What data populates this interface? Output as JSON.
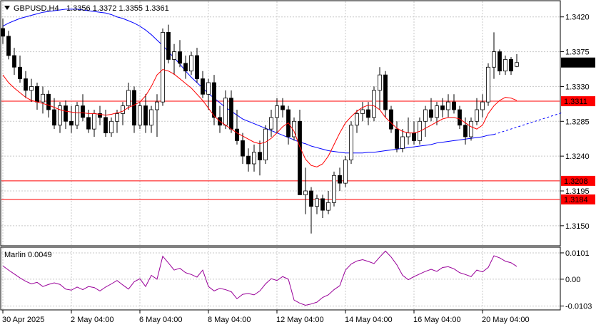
{
  "chart_data": {
    "type": "candlestick",
    "symbol_header": "GBPUSD,H4",
    "ohlc_header": "1.3356 1.3372 1.3355 1.3361",
    "price_axis": {
      "ylim": [
        1.3125,
        1.344
      ],
      "tick_labels": [
        "1.3420",
        "1.3375",
        "1.3330",
        "1.3285",
        "1.3240",
        "1.3195",
        "1.3150"
      ]
    },
    "time_axis": {
      "labels": [
        "30 Apr 2025",
        "2 May 04:00",
        "6 May 04:00",
        "8 May 04:00",
        "12 May 04:00",
        "14 May 04:00",
        "16 May 04:00",
        "20 May 04:00"
      ],
      "label_bar_index": [
        0,
        12,
        24,
        36,
        48,
        60,
        72,
        84
      ]
    },
    "current_price": {
      "value": 1.3361,
      "label": "1.3361"
    },
    "horizontal_levels": [
      {
        "value": 1.3311,
        "label": "1.3311",
        "color": "#ff0000"
      },
      {
        "value": 1.3208,
        "label": "1.3208",
        "color": "#ff0000"
      },
      {
        "value": 1.3184,
        "label": "1.3184",
        "color": "#ff0000"
      }
    ],
    "candles": [
      [
        1.3405,
        1.3418,
        1.3385,
        1.3395
      ],
      [
        1.3395,
        1.3402,
        1.3365,
        1.337
      ],
      [
        1.337,
        1.338,
        1.3345,
        1.3355
      ],
      [
        1.3355,
        1.337,
        1.3335,
        1.334
      ],
      [
        1.334,
        1.335,
        1.3315,
        1.3325
      ],
      [
        1.3325,
        1.334,
        1.331,
        1.333
      ],
      [
        1.333,
        1.3335,
        1.33,
        1.331
      ],
      [
        1.331,
        1.333,
        1.3295,
        1.332
      ],
      [
        1.332,
        1.3325,
        1.329,
        1.33
      ],
      [
        1.33,
        1.3315,
        1.3275,
        1.328
      ],
      [
        1.328,
        1.331,
        1.327,
        1.3305
      ],
      [
        1.3305,
        1.3312,
        1.3275,
        1.3285
      ],
      [
        1.3285,
        1.3305,
        1.327,
        1.328
      ],
      [
        1.328,
        1.331,
        1.3275,
        1.3305
      ],
      [
        1.3305,
        1.332,
        1.3285,
        1.329
      ],
      [
        1.329,
        1.33,
        1.327,
        1.3275
      ],
      [
        1.3275,
        1.33,
        1.3265,
        1.3295
      ],
      [
        1.3295,
        1.3305,
        1.328,
        1.329
      ],
      [
        1.329,
        1.33,
        1.3265,
        1.327
      ],
      [
        1.327,
        1.329,
        1.3265,
        1.3285
      ],
      [
        1.3285,
        1.33,
        1.327,
        1.3295
      ],
      [
        1.3295,
        1.331,
        1.328,
        1.3305
      ],
      [
        1.3305,
        1.3335,
        1.33,
        1.3325
      ],
      [
        1.3325,
        1.333,
        1.327,
        1.328
      ],
      [
        1.328,
        1.331,
        1.3275,
        1.3305
      ],
      [
        1.3305,
        1.332,
        1.327,
        1.328
      ],
      [
        1.328,
        1.3305,
        1.327,
        1.33
      ],
      [
        1.33,
        1.332,
        1.3265,
        1.331
      ],
      [
        1.331,
        1.3405,
        1.3305,
        1.34
      ],
      [
        1.34,
        1.341,
        1.336,
        1.3365
      ],
      [
        1.3365,
        1.3385,
        1.3345,
        1.3375
      ],
      [
        1.3375,
        1.339,
        1.3355,
        1.336
      ],
      [
        1.336,
        1.337,
        1.334,
        1.335
      ],
      [
        1.335,
        1.3375,
        1.3345,
        1.337
      ],
      [
        1.337,
        1.338,
        1.3335,
        1.334
      ],
      [
        1.334,
        1.335,
        1.3315,
        1.332
      ],
      [
        1.332,
        1.334,
        1.33,
        1.3335
      ],
      [
        1.3335,
        1.3345,
        1.328,
        1.329
      ],
      [
        1.329,
        1.3305,
        1.327,
        1.328
      ],
      [
        1.328,
        1.3325,
        1.3275,
        1.3315
      ],
      [
        1.3315,
        1.3325,
        1.327,
        1.3275
      ],
      [
        1.3275,
        1.33,
        1.3255,
        1.326
      ],
      [
        1.326,
        1.327,
        1.323,
        1.324
      ],
      [
        1.324,
        1.325,
        1.322,
        1.323
      ],
      [
        1.323,
        1.3255,
        1.322,
        1.3245
      ],
      [
        1.3245,
        1.326,
        1.3215,
        1.3235
      ],
      [
        1.3235,
        1.328,
        1.323,
        1.3275
      ],
      [
        1.3275,
        1.33,
        1.3265,
        1.329
      ],
      [
        1.329,
        1.3315,
        1.327,
        1.3305
      ],
      [
        1.3305,
        1.3315,
        1.329,
        1.33
      ],
      [
        1.33,
        1.3305,
        1.3255,
        1.3265
      ],
      [
        1.3265,
        1.329,
        1.326,
        1.3285
      ],
      [
        1.3285,
        1.33,
        1.323,
        1.319
      ],
      [
        1.319,
        1.3225,
        1.3165,
        1.3195
      ],
      [
        1.3195,
        1.32,
        1.314,
        1.3175
      ],
      [
        1.3175,
        1.319,
        1.3165,
        1.3185
      ],
      [
        1.3185,
        1.319,
        1.316,
        1.317
      ],
      [
        1.317,
        1.3195,
        1.3165,
        1.318
      ],
      [
        1.318,
        1.322,
        1.3175,
        1.3215
      ],
      [
        1.3215,
        1.3225,
        1.3195,
        1.3205
      ],
      [
        1.3205,
        1.324,
        1.32,
        1.3235
      ],
      [
        1.3235,
        1.3285,
        1.323,
        1.328
      ],
      [
        1.328,
        1.33,
        1.327,
        1.3295
      ],
      [
        1.3295,
        1.331,
        1.3285,
        1.33
      ],
      [
        1.33,
        1.331,
        1.328,
        1.329
      ],
      [
        1.329,
        1.333,
        1.3285,
        1.3325
      ],
      [
        1.3325,
        1.3355,
        1.33,
        1.3345
      ],
      [
        1.3345,
        1.335,
        1.329,
        1.33
      ],
      [
        1.33,
        1.3305,
        1.327,
        1.3275
      ],
      [
        1.3275,
        1.3285,
        1.3245,
        1.325
      ],
      [
        1.325,
        1.3275,
        1.3245,
        1.3265
      ],
      [
        1.3265,
        1.329,
        1.3255,
        1.327
      ],
      [
        1.327,
        1.3285,
        1.3255,
        1.326
      ],
      [
        1.326,
        1.329,
        1.3255,
        1.3285
      ],
      [
        1.3285,
        1.3305,
        1.3265,
        1.33
      ],
      [
        1.33,
        1.3315,
        1.3285,
        1.329
      ],
      [
        1.329,
        1.331,
        1.328,
        1.3305
      ],
      [
        1.3305,
        1.3315,
        1.329,
        1.33
      ],
      [
        1.33,
        1.332,
        1.329,
        1.331
      ],
      [
        1.331,
        1.332,
        1.3295,
        1.33
      ],
      [
        1.33,
        1.3305,
        1.3275,
        1.328
      ],
      [
        1.328,
        1.329,
        1.3255,
        1.3265
      ],
      [
        1.3265,
        1.329,
        1.326,
        1.3285
      ],
      [
        1.3285,
        1.3315,
        1.328,
        1.33
      ],
      [
        1.33,
        1.332,
        1.329,
        1.331
      ],
      [
        1.331,
        1.336,
        1.3305,
        1.3355
      ],
      [
        1.3355,
        1.34,
        1.334,
        1.3375
      ],
      [
        1.3375,
        1.3378,
        1.3345,
        1.335
      ],
      [
        1.335,
        1.337,
        1.3345,
        1.3365
      ],
      [
        1.3365,
        1.3368,
        1.3345,
        1.335
      ],
      [
        1.3356,
        1.3372,
        1.3355,
        1.3361
      ]
    ],
    "ma_fast_color": "#ff0000",
    "ma_slow_color": "#0000ff",
    "ma_fast": [
      1.3345,
      1.3335,
      1.3328,
      1.3322,
      1.3316,
      1.3312,
      1.331,
      1.3308,
      1.3306,
      1.3303,
      1.33,
      1.3298,
      1.3297,
      1.3296,
      1.3296,
      1.3295,
      1.3295,
      1.3294,
      1.3293,
      1.3294,
      1.3296,
      1.3298,
      1.3303,
      1.3306,
      1.331,
      1.3318,
      1.333,
      1.3345,
      1.3352,
      1.335,
      1.3346,
      1.334,
      1.3334,
      1.3328,
      1.332,
      1.3312,
      1.3302,
      1.3292,
      1.3285,
      1.328,
      1.3275,
      1.327,
      1.3266,
      1.3262,
      1.3258,
      1.3256,
      1.3258,
      1.3263,
      1.327,
      1.3278,
      1.3283,
      1.3272,
      1.3252,
      1.3236,
      1.3228,
      1.3226,
      1.323,
      1.324,
      1.3255,
      1.327,
      1.3283,
      1.3291,
      1.3298,
      1.3303,
      1.3306,
      1.3305,
      1.33,
      1.329,
      1.3283,
      1.3276,
      1.3272,
      1.327,
      1.327,
      1.3272,
      1.3276,
      1.328,
      1.3284,
      1.3288,
      1.329,
      1.329,
      1.3288,
      1.3283,
      1.3278,
      1.3275,
      1.328,
      1.3295,
      1.3305,
      1.3312,
      1.3316,
      1.3315,
      1.3312
    ],
    "ma_slow": [
      1.3408,
      1.3412,
      1.3415,
      1.3418,
      1.342,
      1.3422,
      1.3424,
      1.3426,
      1.3427,
      1.3428,
      1.3429,
      1.343,
      1.343,
      1.343,
      1.3429,
      1.3428,
      1.3427,
      1.3426,
      1.3425,
      1.3423,
      1.342,
      1.3418,
      1.3415,
      1.3412,
      1.3408,
      1.3403,
      1.3397,
      1.339,
      1.3383,
      1.3375,
      1.3367,
      1.3359,
      1.335,
      1.3342,
      1.3335,
      1.3328,
      1.3321,
      1.3315,
      1.3309,
      1.3303,
      1.3298,
      1.3293,
      1.3288,
      1.3285,
      1.3282,
      1.3279,
      1.3276,
      1.3273,
      1.327,
      1.3267,
      1.3264,
      1.3261,
      1.3258,
      1.3256,
      1.3253,
      1.3251,
      1.3249,
      1.3247,
      1.3246,
      1.3245,
      1.3244,
      1.3244,
      1.3244,
      1.3244,
      1.3245,
      1.3245,
      1.3246,
      1.3247,
      1.3248,
      1.3249,
      1.325,
      1.3251,
      1.3252,
      1.3253,
      1.3254,
      1.3255,
      1.3257,
      1.3258,
      1.3259,
      1.326,
      1.3261,
      1.3262,
      1.3263,
      1.3264,
      1.3265,
      1.3267,
      1.3268
    ],
    "oscillator": {
      "label": "Marlin 0.0049",
      "color": "#990099",
      "ylim": [
        -0.0115,
        0.012
      ],
      "tick_labels": [
        "0.0101",
        "0.00",
        "-0.0103"
      ],
      "values": [
        0.0051,
        0.0035,
        0.002,
        0.0005,
        -0.0008,
        -0.0018,
        -0.0012,
        -0.0028,
        -0.002,
        -0.0014,
        -0.002,
        -0.0038,
        -0.0042,
        -0.003,
        -0.004,
        -0.0028,
        -0.0032,
        -0.0045,
        -0.003,
        -0.0018,
        -0.0005,
        -0.0022,
        -0.0038,
        -0.001,
        0.0002,
        -0.0028,
        0.0015,
        0.0,
        0.0088,
        0.0062,
        0.0035,
        0.0042,
        0.0025,
        0.0018,
        0.0008,
        0.0035,
        -0.0028,
        -0.0045,
        -0.0035,
        -0.004,
        -0.0048,
        -0.0075,
        -0.0058,
        -0.0055,
        -0.006,
        -0.0045,
        -0.0018,
        0.0002,
        -0.0005,
        0.001,
        0.0,
        -0.008,
        -0.0092,
        -0.01,
        -0.0095,
        -0.0088,
        -0.007,
        -0.006,
        -0.004,
        -0.0025,
        0.0035,
        0.0058,
        0.007,
        0.0075,
        0.0068,
        0.006,
        0.0085,
        0.0108,
        0.0085,
        0.0055,
        0.0015,
        -0.0002,
        0.001,
        0.002,
        0.003,
        0.0038,
        0.003,
        0.0045,
        0.0048,
        0.004,
        0.0025,
        0.0018,
        0.001,
        0.0035,
        0.0028,
        0.0045,
        0.009,
        0.0082,
        0.0069,
        0.0063,
        0.0049
      ]
    }
  }
}
